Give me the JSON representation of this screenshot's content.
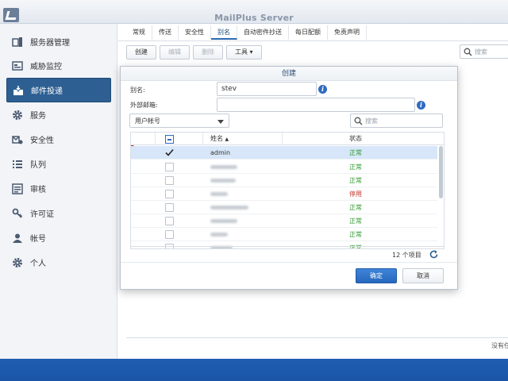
{
  "window": {
    "title": "MailPlus Server"
  },
  "sidebar": {
    "items": [
      {
        "label": "服务器管理",
        "icon": "server-management-icon",
        "active": false
      },
      {
        "label": "威胁监控",
        "icon": "threat-monitor-icon",
        "active": false
      },
      {
        "label": "邮件投递",
        "icon": "mail-delivery-icon",
        "active": true
      },
      {
        "label": "服务",
        "icon": "service-gear-icon",
        "active": false
      },
      {
        "label": "安全性",
        "icon": "security-icon",
        "active": false
      },
      {
        "label": "队列",
        "icon": "queue-icon",
        "active": false
      },
      {
        "label": "审核",
        "icon": "audit-icon",
        "active": false
      },
      {
        "label": "许可证",
        "icon": "license-key-icon",
        "active": false
      },
      {
        "label": "帐号",
        "icon": "account-icon",
        "active": false
      },
      {
        "label": "个人",
        "icon": "personal-gear-icon",
        "active": false
      }
    ]
  },
  "main": {
    "tabs": [
      "常规",
      "传送",
      "安全性",
      "别名",
      "自动密件抄送",
      "每日配额",
      "免责声明"
    ],
    "active_tab": "别名",
    "toolbar": {
      "create": "创建",
      "edit": "编辑",
      "delete": "删除",
      "tools": "工具"
    },
    "search_placeholder": "搜索",
    "status_text": "没有任"
  },
  "dialog": {
    "title": "创建",
    "alias_label": "别名:",
    "alias_value": "stev",
    "external_label": "外部邮箱:",
    "external_value": "",
    "account_type": "用户帐号",
    "search_placeholder": "搜索",
    "table": {
      "col_name": "姓名",
      "col_status": "状态",
      "rows": [
        {
          "name": "admin",
          "status": "正常",
          "checked": true,
          "ok": true
        },
        {
          "name": "",
          "status": "正常",
          "checked": false,
          "ok": true
        },
        {
          "name": "",
          "status": "正常",
          "checked": false,
          "ok": true
        },
        {
          "name": "",
          "status": "停用",
          "checked": false,
          "ok": false
        },
        {
          "name": "",
          "status": "正常",
          "checked": false,
          "ok": true
        },
        {
          "name": "",
          "status": "正常",
          "checked": false,
          "ok": true
        },
        {
          "name": "",
          "status": "正常",
          "checked": false,
          "ok": true
        },
        {
          "name": "",
          "status": "正常",
          "checked": false,
          "ok": true
        }
      ]
    },
    "item_count": "12 个项目",
    "ok_label": "确定",
    "cancel_label": "取消"
  },
  "colors": {
    "accent": "#2d5f92",
    "ok_status": "#2e9a2e",
    "disabled_status": "#c0392b",
    "primary_button": "#2767bd"
  }
}
